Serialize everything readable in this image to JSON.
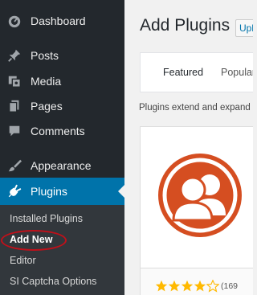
{
  "sidebar": {
    "items": [
      {
        "label": "Dashboard",
        "icon": "dashboard-icon"
      },
      {
        "label": "Posts",
        "icon": "pin-icon"
      },
      {
        "label": "Media",
        "icon": "media-icon"
      },
      {
        "label": "Pages",
        "icon": "pages-icon"
      },
      {
        "label": "Comments",
        "icon": "comments-icon"
      },
      {
        "label": "Appearance",
        "icon": "brush-icon"
      },
      {
        "label": "Plugins",
        "icon": "plugin-plug-icon"
      }
    ],
    "submenu": [
      {
        "label": "Installed Plugins"
      },
      {
        "label": "Add New"
      },
      {
        "label": "Editor"
      },
      {
        "label": "SI Captcha Options"
      }
    ]
  },
  "main": {
    "title": "Add Plugins",
    "upload_label": "Upload Plugin",
    "tabs": [
      {
        "label": "Featured"
      },
      {
        "label": "Popular"
      }
    ],
    "intro_text": "Plugins extend and expand the functionality of WordPress."
  },
  "plugin_card": {
    "icon": "users-group-icon",
    "rating": 4,
    "rating_count": "(169"
  },
  "colors": {
    "sidebar_bg": "#23282d",
    "submenu_bg": "#32373c",
    "active_blue": "#0073aa",
    "plugin_orange": "#d54e21",
    "star_gold": "#ffb900",
    "annotation_red": "#c0101a"
  }
}
